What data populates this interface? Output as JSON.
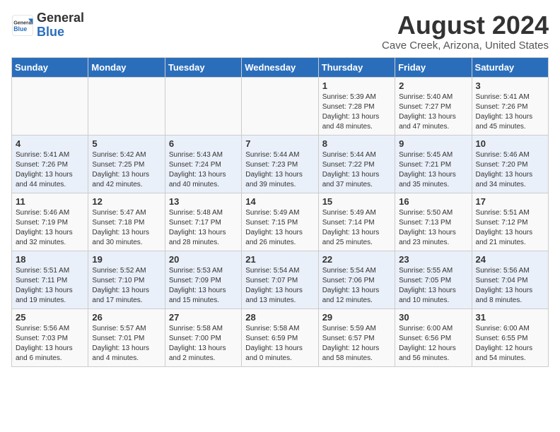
{
  "header": {
    "logo_general": "General",
    "logo_blue": "Blue",
    "title": "August 2024",
    "subtitle": "Cave Creek, Arizona, United States"
  },
  "weekdays": [
    "Sunday",
    "Monday",
    "Tuesday",
    "Wednesday",
    "Thursday",
    "Friday",
    "Saturday"
  ],
  "weeks": [
    [
      {
        "day": "",
        "info": ""
      },
      {
        "day": "",
        "info": ""
      },
      {
        "day": "",
        "info": ""
      },
      {
        "day": "",
        "info": ""
      },
      {
        "day": "1",
        "info": "Sunrise: 5:39 AM\nSunset: 7:28 PM\nDaylight: 13 hours\nand 48 minutes."
      },
      {
        "day": "2",
        "info": "Sunrise: 5:40 AM\nSunset: 7:27 PM\nDaylight: 13 hours\nand 47 minutes."
      },
      {
        "day": "3",
        "info": "Sunrise: 5:41 AM\nSunset: 7:26 PM\nDaylight: 13 hours\nand 45 minutes."
      }
    ],
    [
      {
        "day": "4",
        "info": "Sunrise: 5:41 AM\nSunset: 7:26 PM\nDaylight: 13 hours\nand 44 minutes."
      },
      {
        "day": "5",
        "info": "Sunrise: 5:42 AM\nSunset: 7:25 PM\nDaylight: 13 hours\nand 42 minutes."
      },
      {
        "day": "6",
        "info": "Sunrise: 5:43 AM\nSunset: 7:24 PM\nDaylight: 13 hours\nand 40 minutes."
      },
      {
        "day": "7",
        "info": "Sunrise: 5:44 AM\nSunset: 7:23 PM\nDaylight: 13 hours\nand 39 minutes."
      },
      {
        "day": "8",
        "info": "Sunrise: 5:44 AM\nSunset: 7:22 PM\nDaylight: 13 hours\nand 37 minutes."
      },
      {
        "day": "9",
        "info": "Sunrise: 5:45 AM\nSunset: 7:21 PM\nDaylight: 13 hours\nand 35 minutes."
      },
      {
        "day": "10",
        "info": "Sunrise: 5:46 AM\nSunset: 7:20 PM\nDaylight: 13 hours\nand 34 minutes."
      }
    ],
    [
      {
        "day": "11",
        "info": "Sunrise: 5:46 AM\nSunset: 7:19 PM\nDaylight: 13 hours\nand 32 minutes."
      },
      {
        "day": "12",
        "info": "Sunrise: 5:47 AM\nSunset: 7:18 PM\nDaylight: 13 hours\nand 30 minutes."
      },
      {
        "day": "13",
        "info": "Sunrise: 5:48 AM\nSunset: 7:17 PM\nDaylight: 13 hours\nand 28 minutes."
      },
      {
        "day": "14",
        "info": "Sunrise: 5:49 AM\nSunset: 7:15 PM\nDaylight: 13 hours\nand 26 minutes."
      },
      {
        "day": "15",
        "info": "Sunrise: 5:49 AM\nSunset: 7:14 PM\nDaylight: 13 hours\nand 25 minutes."
      },
      {
        "day": "16",
        "info": "Sunrise: 5:50 AM\nSunset: 7:13 PM\nDaylight: 13 hours\nand 23 minutes."
      },
      {
        "day": "17",
        "info": "Sunrise: 5:51 AM\nSunset: 7:12 PM\nDaylight: 13 hours\nand 21 minutes."
      }
    ],
    [
      {
        "day": "18",
        "info": "Sunrise: 5:51 AM\nSunset: 7:11 PM\nDaylight: 13 hours\nand 19 minutes."
      },
      {
        "day": "19",
        "info": "Sunrise: 5:52 AM\nSunset: 7:10 PM\nDaylight: 13 hours\nand 17 minutes."
      },
      {
        "day": "20",
        "info": "Sunrise: 5:53 AM\nSunset: 7:09 PM\nDaylight: 13 hours\nand 15 minutes."
      },
      {
        "day": "21",
        "info": "Sunrise: 5:54 AM\nSunset: 7:07 PM\nDaylight: 13 hours\nand 13 minutes."
      },
      {
        "day": "22",
        "info": "Sunrise: 5:54 AM\nSunset: 7:06 PM\nDaylight: 13 hours\nand 12 minutes."
      },
      {
        "day": "23",
        "info": "Sunrise: 5:55 AM\nSunset: 7:05 PM\nDaylight: 13 hours\nand 10 minutes."
      },
      {
        "day": "24",
        "info": "Sunrise: 5:56 AM\nSunset: 7:04 PM\nDaylight: 13 hours\nand 8 minutes."
      }
    ],
    [
      {
        "day": "25",
        "info": "Sunrise: 5:56 AM\nSunset: 7:03 PM\nDaylight: 13 hours\nand 6 minutes."
      },
      {
        "day": "26",
        "info": "Sunrise: 5:57 AM\nSunset: 7:01 PM\nDaylight: 13 hours\nand 4 minutes."
      },
      {
        "day": "27",
        "info": "Sunrise: 5:58 AM\nSunset: 7:00 PM\nDaylight: 13 hours\nand 2 minutes."
      },
      {
        "day": "28",
        "info": "Sunrise: 5:58 AM\nSunset: 6:59 PM\nDaylight: 13 hours\nand 0 minutes."
      },
      {
        "day": "29",
        "info": "Sunrise: 5:59 AM\nSunset: 6:57 PM\nDaylight: 12 hours\nand 58 minutes."
      },
      {
        "day": "30",
        "info": "Sunrise: 6:00 AM\nSunset: 6:56 PM\nDaylight: 12 hours\nand 56 minutes."
      },
      {
        "day": "31",
        "info": "Sunrise: 6:00 AM\nSunset: 6:55 PM\nDaylight: 12 hours\nand 54 minutes."
      }
    ]
  ]
}
